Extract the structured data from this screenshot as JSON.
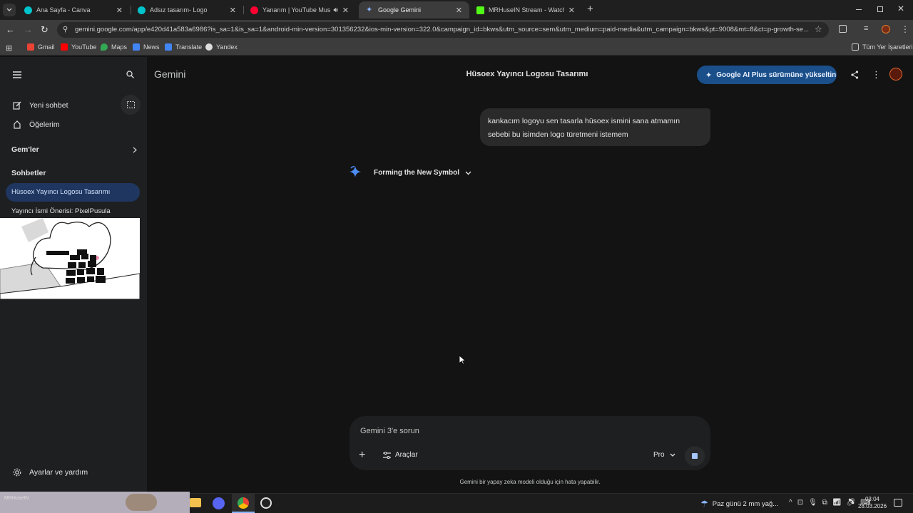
{
  "browser": {
    "tabs": [
      {
        "title": "Ana Sayfa - Canva",
        "active": false
      },
      {
        "title": "Adsız tasarım- Logo",
        "active": false
      },
      {
        "title": "Yanarım | YouTube Music",
        "active": false
      },
      {
        "title": "Google Gemini",
        "active": true
      },
      {
        "title": "MRHuseIN Stream - Watch Live",
        "active": false
      }
    ],
    "url": "gemini.google.com/app/e420d41a583a6986?is_sa=1&is_sa=1&android-min-version=301356232&ios-min-version=322.0&campaign_id=bkws&utm_source=sem&utm_medium=paid-media&utm_campaign=bkws&pt=9008&mt=8&ct=p-growth-se...",
    "bookmarks": [
      "Gmail",
      "YouTube",
      "Maps",
      "News",
      "Translate",
      "Yandex"
    ],
    "all_bookmarks": "Tüm Yer İşaretleri"
  },
  "sidebar": {
    "new_chat": "Yeni sohbet",
    "my_stuff": "Öğelerim",
    "gems": "Gem'ler",
    "chats_heading": "Sohbetler",
    "chats": [
      "Hüsoex Yayıncı Logosu Tasarımı",
      "Yayıncı İsmi Önerisi: PixelPusula"
    ],
    "settings": "Ayarlar ve yardım"
  },
  "main": {
    "app_name": "Gemini",
    "conversation_title": "Hüsoex Yayıncı Logosu Tasarımı",
    "upgrade_label": "Google AI Plus sürümüne yükseltin",
    "user_message": "kankacım logoyu sen tasarla hüsoex ismini sana atmamın sebebi bu isimden logo türetmeni istemem",
    "thinking_label": "Forming the New Symbol",
    "input_placeholder": "Gemini 3'e sorun",
    "tools_label": "Araçlar",
    "model_label": "Pro",
    "disclaimer": "Gemini bir yapay zeka modeli olduğu için hata yapabilir."
  },
  "overlay": {
    "stream_name": "MRHuseIN"
  },
  "taskbar": {
    "weather": "Paz günü 2 mm yağ...",
    "time": "03:04",
    "date": "28.03.2026"
  },
  "colors": {
    "page_bg": "#131314",
    "sidebar_bg": "#1e1f20",
    "active_chat": "#1f3760",
    "upgrade_button": "#1a4f8a",
    "gemini_blue": "#4c8df6"
  }
}
